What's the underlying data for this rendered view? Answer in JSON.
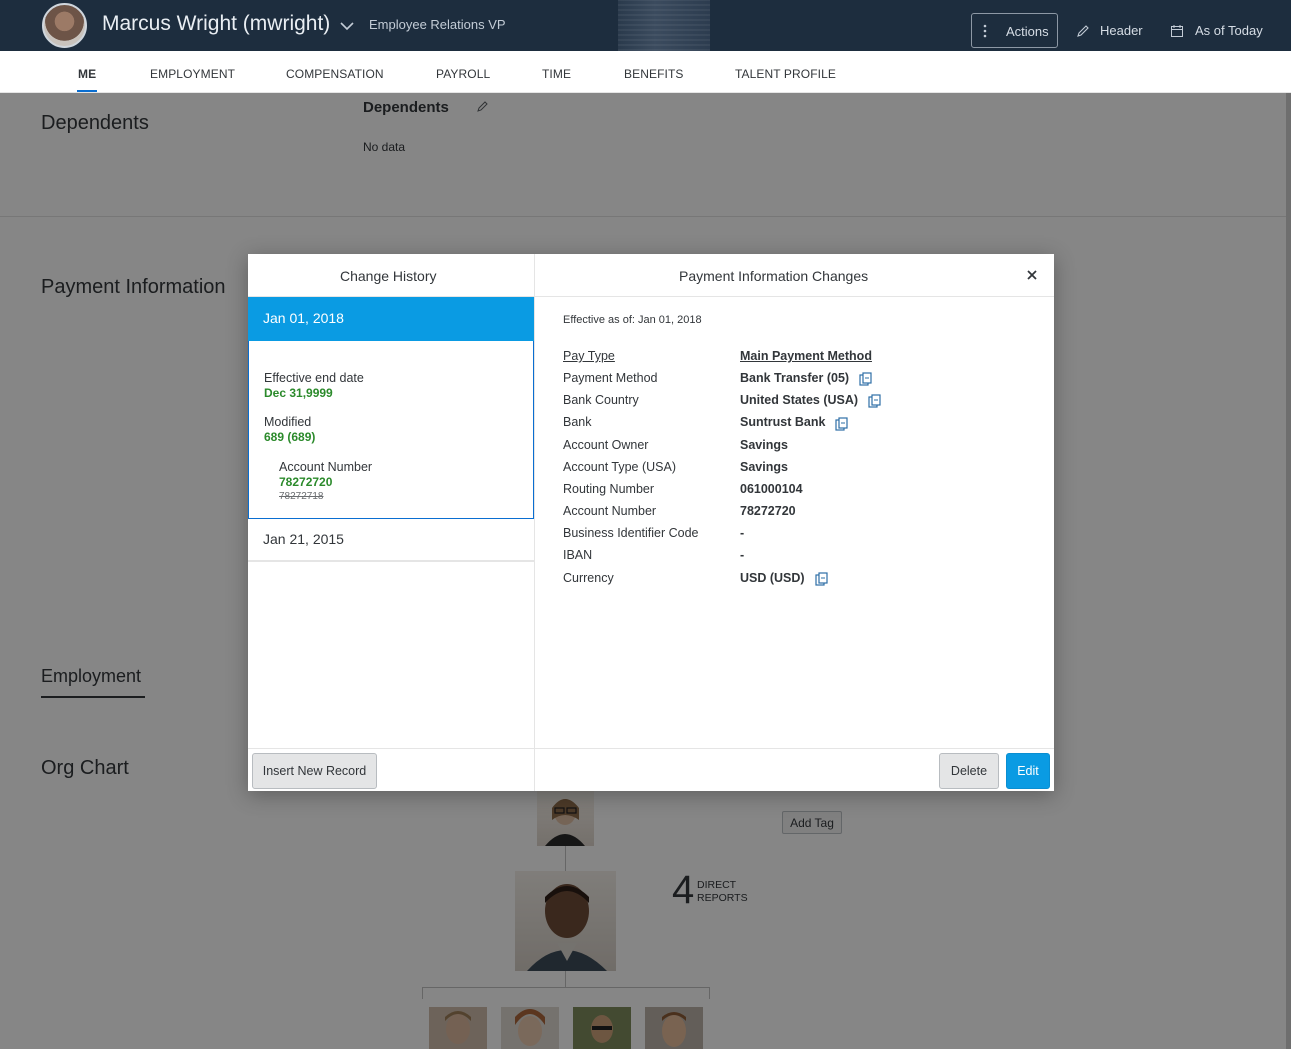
{
  "header": {
    "employee_name": "Marcus Wright (mwright)",
    "employee_title": "Employee Relations VP",
    "actions_label": "Actions",
    "header_label": "Header",
    "as_of_label": "As of Today"
  },
  "tabs": [
    {
      "label": "ME",
      "active": true
    },
    {
      "label": "EMPLOYMENT"
    },
    {
      "label": "COMPENSATION"
    },
    {
      "label": "PAYROLL"
    },
    {
      "label": "TIME"
    },
    {
      "label": "BENEFITS"
    },
    {
      "label": "TALENT PROFILE"
    }
  ],
  "background": {
    "dependents_section": "Dependents",
    "dependents_card_title": "Dependents",
    "dependents_nodata": "No data",
    "payment_section": "Payment Information",
    "employment_section": "Employment",
    "org_chart_section": "Org Chart",
    "add_tag": "Add Tag",
    "direct_reports_count": "4",
    "direct_reports_label_1": "DIRECT",
    "direct_reports_label_2": "REPORTS"
  },
  "dialog": {
    "left_title": "Change History",
    "right_title": "Payment Information Changes",
    "history": [
      {
        "date": "Jan 01, 2018",
        "selected": true,
        "effective_end_label": "Effective end date",
        "effective_end_value": "Dec 31,9999",
        "modified_label": "Modified",
        "modified_value": "689 (689)",
        "change_field": "Account Number",
        "change_new": "78272720",
        "change_old": "78272718"
      },
      {
        "date": "Jan 21, 2015",
        "selected": false
      }
    ],
    "effective_as_of": "Effective as of: Jan 01, 2018",
    "fields": [
      {
        "label": "Pay Type",
        "value": "Main Payment Method",
        "underline": true
      },
      {
        "label": "Payment Method",
        "value": "Bank Transfer (05)",
        "copy": true
      },
      {
        "label": "Bank Country",
        "value": "United States (USA)",
        "copy": true
      },
      {
        "label": "Bank",
        "value": "Suntrust Bank",
        "copy": true
      },
      {
        "label": "Account Owner",
        "value": "Savings"
      },
      {
        "label": "Account Type (USA)",
        "value": "Savings"
      },
      {
        "label": "Routing Number",
        "value": "061000104"
      },
      {
        "label": "Account Number",
        "value": "78272720"
      },
      {
        "label": "Business Identifier Code",
        "value": "-"
      },
      {
        "label": "IBAN",
        "value": "-"
      },
      {
        "label": "Currency",
        "value": "USD (USD)",
        "copy": true
      }
    ],
    "insert_button": "Insert New Record",
    "delete_button": "Delete",
    "edit_button": "Edit"
  },
  "colors": {
    "header_bg": "#1d2d3e",
    "accent": "#0a9be3",
    "changed_value": "#2b8a2b"
  }
}
